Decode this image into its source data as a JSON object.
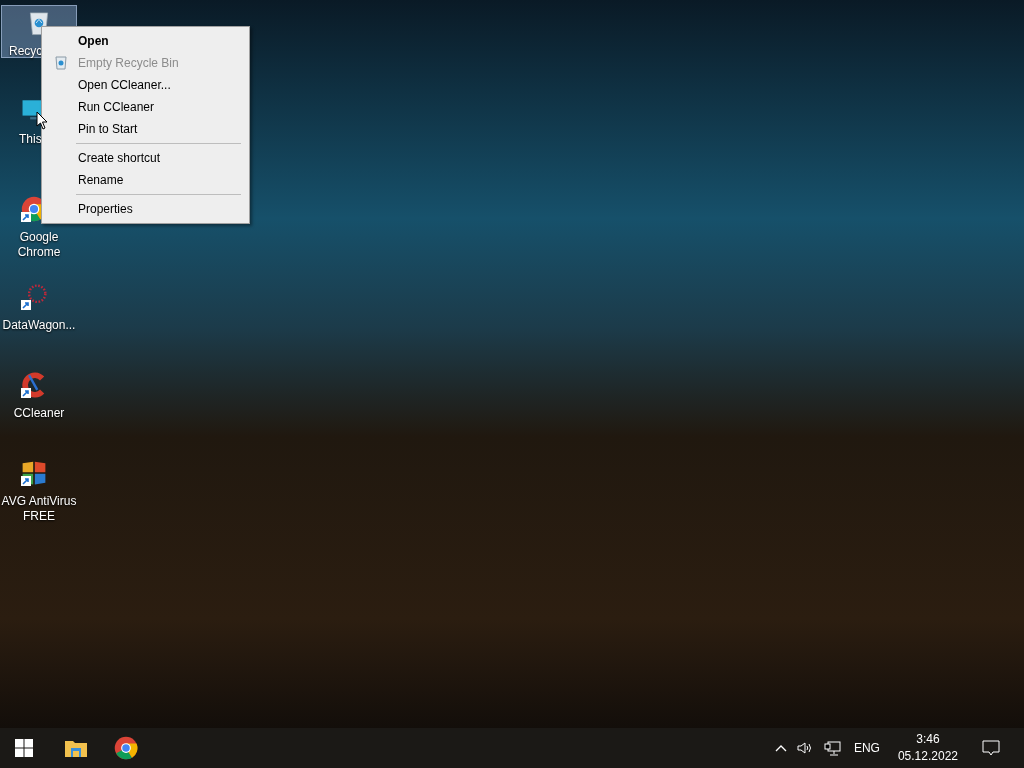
{
  "desktop_icons": [
    {
      "kind": "recycle",
      "label": "Recyc",
      "selected": true
    },
    {
      "kind": "pc",
      "label": "This",
      "selected": false
    },
    {
      "kind": "chrome",
      "label": "Google Chrome",
      "selected": false
    },
    {
      "kind": "datawagon",
      "label": "DataWagon...",
      "selected": false
    },
    {
      "kind": "ccleaner",
      "label": "CCleaner",
      "selected": false
    },
    {
      "kind": "avg",
      "label": "AVG AntiVirus FREE",
      "selected": false
    }
  ],
  "context_menu": {
    "items": [
      {
        "kind": "item",
        "label": "Open",
        "default": true,
        "disabled": false
      },
      {
        "kind": "icon_item",
        "label": "Empty Recycle Bin",
        "default": false,
        "disabled": true
      },
      {
        "kind": "item",
        "label": "Open CCleaner...",
        "default": false,
        "disabled": false
      },
      {
        "kind": "item",
        "label": "Run CCleaner",
        "default": false,
        "disabled": false
      },
      {
        "kind": "item",
        "label": "Pin to Start",
        "default": false,
        "disabled": false
      },
      {
        "kind": "separator"
      },
      {
        "kind": "item",
        "label": "Create shortcut",
        "default": false,
        "disabled": false
      },
      {
        "kind": "item",
        "label": "Rename",
        "default": false,
        "disabled": false
      },
      {
        "kind": "separator"
      },
      {
        "kind": "item",
        "label": "Properties",
        "default": false,
        "disabled": false
      }
    ]
  },
  "taskbar": {
    "apps": [
      {
        "kind": "explorer"
      },
      {
        "kind": "chrome"
      }
    ],
    "tray": {
      "language": "ENG",
      "time": "3:46",
      "date": "05.12.2022"
    }
  }
}
